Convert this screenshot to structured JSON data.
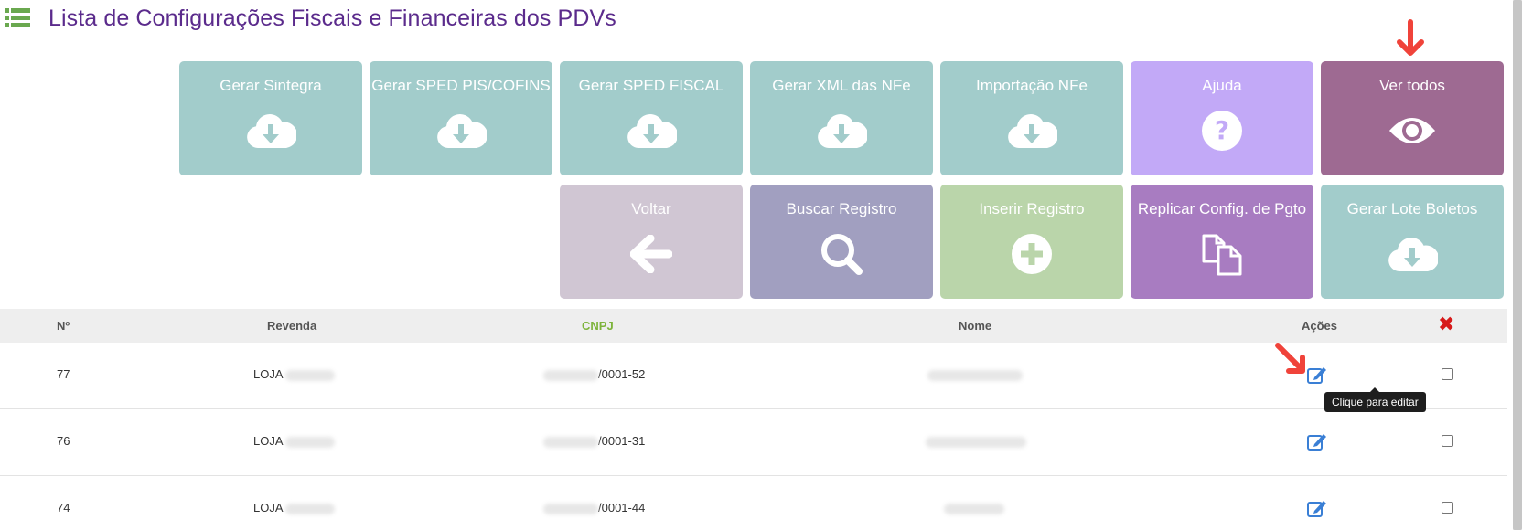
{
  "page": {
    "title": "Lista de Configurações Fiscais e Financeiras dos PDVs",
    "icon": "list-icon",
    "title_color": "#5b2b8c"
  },
  "tiles_row1": [
    {
      "label": "Gerar Sintegra",
      "icon": "cloud-download-icon",
      "color": "#a2cccb"
    },
    {
      "label": "Gerar SPED PIS/COFINS",
      "icon": "cloud-download-icon",
      "color": "#a2cccb"
    },
    {
      "label": "Gerar SPED FISCAL",
      "icon": "cloud-download-icon",
      "color": "#a2cccb"
    },
    {
      "label": "Gerar XML das NFe",
      "icon": "cloud-download-icon",
      "color": "#a2cccb"
    },
    {
      "label": "Importação NFe",
      "icon": "cloud-download-icon",
      "color": "#a2cccb"
    },
    {
      "label": "Ajuda",
      "icon": "question-circle-icon",
      "color": "#c2a9f7"
    },
    {
      "label": "Ver todos",
      "icon": "eye-icon",
      "color": "#9e6a92"
    }
  ],
  "tiles_row2": [
    {
      "label": "Voltar",
      "icon": "arrow-left-icon",
      "color": "#d0c6d3"
    },
    {
      "label": "Buscar Registro",
      "icon": "search-icon",
      "color": "#a19fc0"
    },
    {
      "label": "Inserir Registro",
      "icon": "plus-circle-icon",
      "color": "#bad5aa"
    },
    {
      "label": "Replicar Config. de Pgto",
      "icon": "copy-icon",
      "color": "#a87cc1"
    },
    {
      "label": "Gerar Lote Boletos",
      "icon": "cloud-download-icon",
      "color": "#a2cccb"
    }
  ],
  "table": {
    "headers": {
      "num": "Nº",
      "revenda": "Revenda",
      "cnpj": "CNPJ",
      "nome": "Nome",
      "acoes": "Ações",
      "delete": "✖"
    },
    "rows": [
      {
        "num": "77",
        "revenda": "LOJA",
        "cnpj_suffix": "/0001-52"
      },
      {
        "num": "76",
        "revenda": "LOJA",
        "cnpj_suffix": "/0001-31"
      },
      {
        "num": "74",
        "revenda": "LOJA",
        "cnpj_suffix": "/0001-44"
      }
    ],
    "edit_tooltip": "Clique para editar"
  },
  "annotation_color": "#f0433a"
}
